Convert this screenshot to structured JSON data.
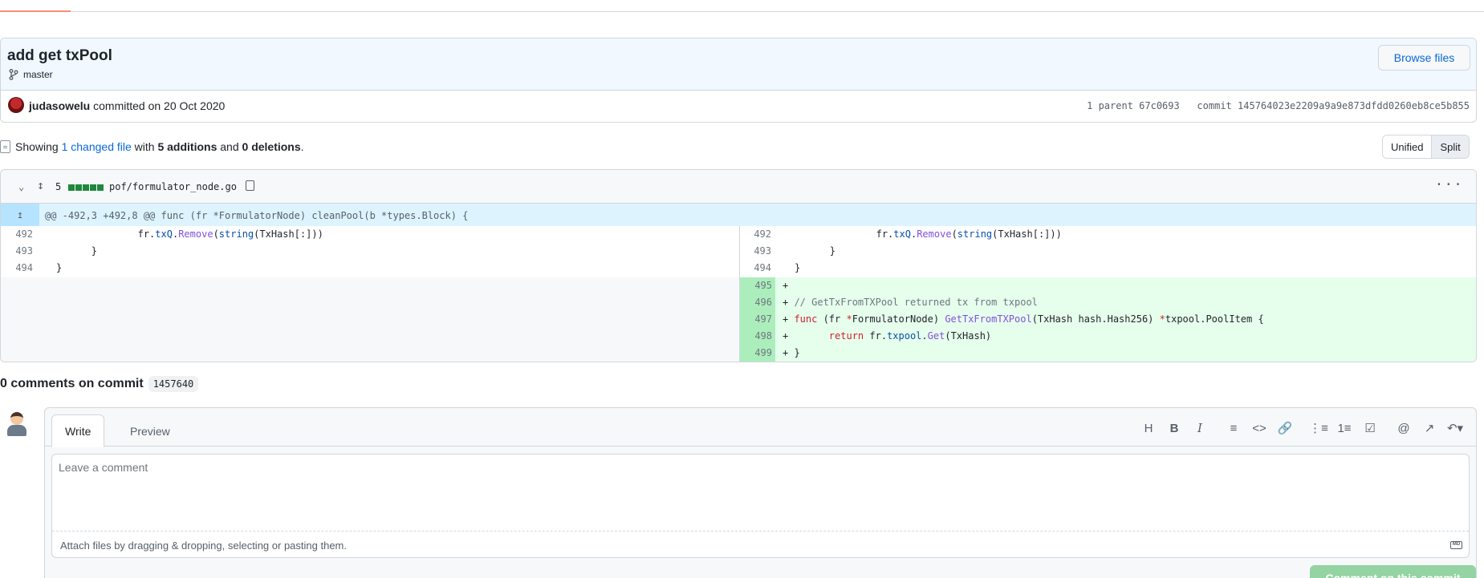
{
  "commit": {
    "title": "add get txPool",
    "branch": "master",
    "browse_label": "Browse files",
    "author": "judasowelu",
    "committed_text": " committed on 20 Oct 2020",
    "parent_label": "1 parent",
    "parent_sha": "67c0693",
    "commit_label": "commit",
    "commit_sha": "145764023e2209a9a9e873dfdd0260eb8ce5b855"
  },
  "summary": {
    "showing": "Showing ",
    "changed": "1 changed file",
    "with": " with ",
    "additions": "5 additions",
    "and": " and ",
    "deletions": "0 deletions",
    "period": "."
  },
  "view_toggle": {
    "unified": "Unified",
    "split": "Split",
    "selected": "Split"
  },
  "diff": {
    "change_count": "5",
    "additions_bar": 5,
    "filename": "pof/formulator_node.go",
    "hunk": "@@ -492,3 +492,8 @@ func (fr *FormulatorNode) cleanPool(b *types.Block) {",
    "context_lines": [
      {
        "num": "492",
        "text": "                fr.txQ.Remove(string(TxHash[:]))"
      },
      {
        "num": "493",
        "text": "        }"
      },
      {
        "num": "494",
        "text": "}"
      }
    ],
    "added_lines": [
      {
        "num": "495",
        "text": "+"
      },
      {
        "num": "496",
        "text": "+ // GetTxFromTXPool returned tx from txpool"
      },
      {
        "num": "497",
        "text": "+ func (fr *FormulatorNode) GetTxFromTXPool(TxHash hash.Hash256) *txpool.PoolItem {"
      },
      {
        "num": "498",
        "text": "+       return fr.txpool.Get(TxHash)"
      },
      {
        "num": "499",
        "text": "+ }"
      }
    ]
  },
  "comments": {
    "title": "0 comments on commit",
    "short_sha": "1457640",
    "tab_write": "Write",
    "tab_preview": "Preview",
    "placeholder": "Leave a comment",
    "attach_hint": "Attach files by dragging & dropping, selecting or pasting them.",
    "submit_label": "Comment on this commit",
    "toolbar": [
      "heading-icon",
      "bold-icon",
      "italic-icon",
      "quote-icon",
      "code-icon",
      "link-icon",
      "unordered-list-icon",
      "ordered-list-icon",
      "task-list-icon",
      "mention-icon",
      "reference-icon",
      "reply-icon"
    ]
  },
  "colors": {
    "accent": "#0969da",
    "add_bg": "#e6ffec",
    "add_gutter": "#aceebb",
    "hunk_bg": "#ddf4ff",
    "submit": "#94d3a2"
  }
}
